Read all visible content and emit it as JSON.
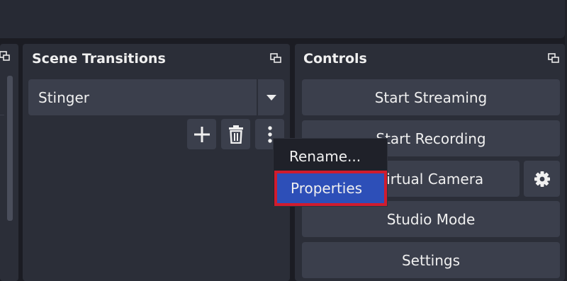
{
  "scene_transitions": {
    "title": "Scene Transitions",
    "transition_value": "Stinger"
  },
  "controls": {
    "title": "Controls",
    "buttons": [
      "Start Streaming",
      "Start Recording",
      "Start Virtual Camera",
      "Studio Mode",
      "Settings"
    ]
  },
  "context_menu": {
    "items": [
      "Rename...",
      "Properties"
    ],
    "selected": "Properties"
  },
  "colors": {
    "selected_item": "#2d4fb8",
    "highlight_border": "#d01c2e"
  }
}
